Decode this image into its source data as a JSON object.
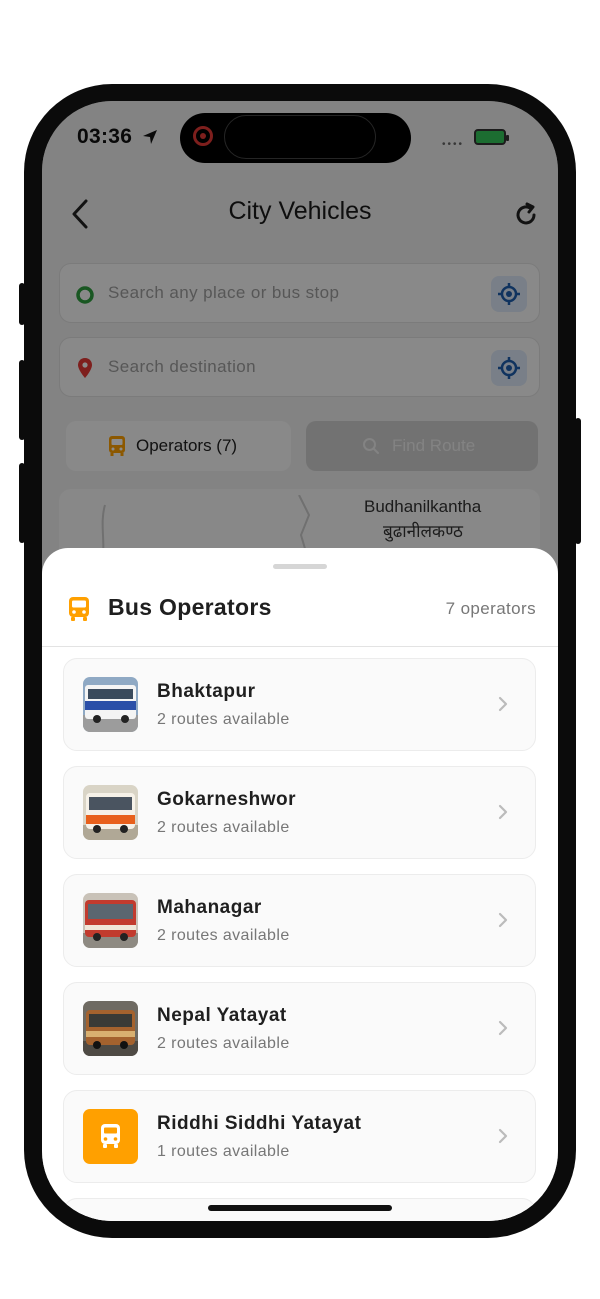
{
  "status_bar": {
    "time": "03:36"
  },
  "header": {
    "title": "City Vehicles"
  },
  "search": {
    "origin_placeholder": "Search any place or bus stop",
    "destination_placeholder": "Search destination"
  },
  "actions": {
    "operators_label": "Operators (7)",
    "find_route_label": "Find Route"
  },
  "map_card": {
    "line1": "Budhanilkantha",
    "line2": "बुढानीलकण्ठ"
  },
  "sheet": {
    "title": "Bus Operators",
    "count": "7 operators",
    "operators": [
      {
        "name": "Bhaktapur",
        "routes": "2 routes available",
        "thumb": "bus-photo-blue"
      },
      {
        "name": "Gokarneshwor",
        "routes": "2 routes available",
        "thumb": "bus-photo-orange"
      },
      {
        "name": "Mahanagar",
        "routes": "2 routes available",
        "thumb": "bus-photo-red"
      },
      {
        "name": "Nepal Yatayat",
        "routes": "2 routes available",
        "thumb": "bus-photo-brown"
      },
      {
        "name": "Riddhi Siddhi Yatayat",
        "routes": "1 routes available",
        "thumb": "bus-icon"
      }
    ]
  },
  "colors": {
    "accent_orange": "#FFA000",
    "origin_green": "#2E9E3E",
    "dest_red": "#E53935",
    "locate_blue": "#1E5EAD"
  }
}
